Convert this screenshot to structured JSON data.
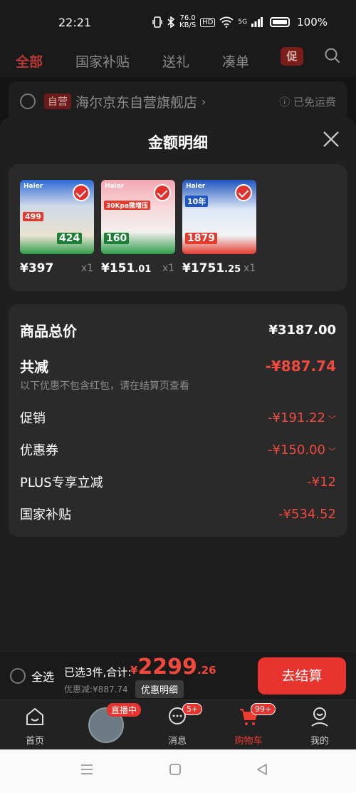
{
  "status": {
    "time": "22:21",
    "net_speed": "76.0",
    "net_unit": "KB/S",
    "battery": "100%",
    "signal": "5G"
  },
  "tabs": {
    "all": "全部",
    "subsidy": "国家补贴",
    "gift": "送礼",
    "bundle": "凑单",
    "promo": "促"
  },
  "store": {
    "badge": "自营",
    "name": "海尔京东自营旗舰店",
    "chevron": "›",
    "free_ship": "已免运费"
  },
  "sheet": {
    "title": "金额明细"
  },
  "products": [
    {
      "brand": "Haier",
      "tag": "499",
      "tag2": "424",
      "price_int": "¥397",
      "price_dec": "",
      "qty": "x1"
    },
    {
      "brand": "Haier",
      "tag": "30Kpa微增压",
      "tag2": "160",
      "price_int": "¥151",
      "price_dec": ".01",
      "qty": "x1"
    },
    {
      "brand": "Haier",
      "tag": "10年",
      "tag2": "1879",
      "price_int": "¥1751",
      "price_dec": ".25",
      "qty": "x1"
    }
  ],
  "summary": {
    "total_label": "商品总价",
    "total_value": "¥3187.00",
    "reduce_label": "共减",
    "reduce_value": "-¥887.74",
    "note": "以下优惠不包含红包，请在结算页查看",
    "promo_label": "促销",
    "promo_value": "-¥191.22",
    "coupon_label": "优惠券",
    "coupon_value": "-¥150.00",
    "plus_label": "PLUS专享立减",
    "plus_value": "-¥12",
    "subsidy_label": "国家补贴",
    "subsidy_value": "-¥534.52"
  },
  "bottom": {
    "select_all": "全选",
    "selected_text": "已选3件,合计:",
    "currency": "¥",
    "amount_int": "2299",
    "amount_dec": ".26",
    "discount_text": "优惠减:¥887.74",
    "detail_tag": "优惠明细",
    "checkout": "去结算"
  },
  "nav": {
    "home": "首页",
    "live": "直播中",
    "msg": "消息",
    "msg_badge": "5+",
    "cart": "购物车",
    "cart_badge": "99+",
    "me": "我的"
  },
  "colors": {
    "accent": "#e8342f",
    "red_text": "#f04a3e",
    "bg": "#1f1f1f",
    "card": "#2a2a2a"
  }
}
